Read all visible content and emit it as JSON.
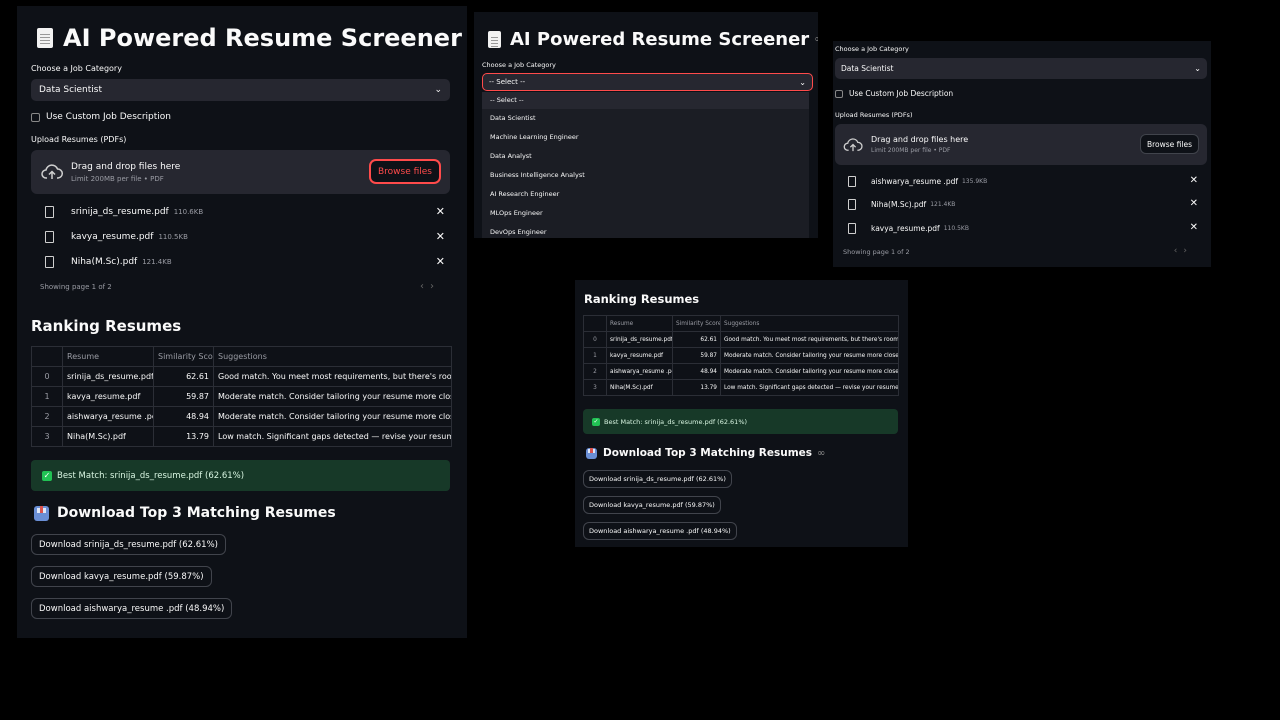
{
  "app": {
    "title": "AI Powered Resume Screener"
  },
  "form": {
    "category_label": "Choose a Job Category",
    "category_value": "Data Scientist",
    "category_placeholder": "-- Select --",
    "custom_jd_label": "Use Custom Job Description",
    "upload_label": "Upload Resumes (PDFs)",
    "drop_text": "Drag and drop files here",
    "limit_text": "Limit 200MB per file • PDF",
    "browse_label": "Browse files",
    "pager_text": "Showing page 1 of 2",
    "dropdown_options": [
      "-- Select --",
      "Data Scientist",
      "Machine Learning Engineer",
      "Data Analyst",
      "Business Intelligence Analyst",
      "AI Research Engineer",
      "MLOps Engineer",
      "DevOps Engineer"
    ]
  },
  "files_panel1": [
    {
      "name": "srinija_ds_resume.pdf",
      "size": "110.6KB"
    },
    {
      "name": "kavya_resume.pdf",
      "size": "110.5KB"
    },
    {
      "name": "Niha(M.Sc).pdf",
      "size": "121.4KB"
    }
  ],
  "files_panel3": [
    {
      "name": "aishwarya_resume .pdf",
      "size": "135.9KB"
    },
    {
      "name": "Niha(M.Sc).pdf",
      "size": "121.4KB"
    },
    {
      "name": "kavya_resume.pdf",
      "size": "110.5KB"
    }
  ],
  "ranking": {
    "heading": "Ranking Resumes",
    "columns": [
      "",
      "Resume",
      "Similarity Score",
      "Suggestions"
    ],
    "rows": [
      {
        "idx": "0",
        "resume": "srinija_ds_resume.pdf",
        "score": "62.61",
        "suggestion": "Good match. You meet most requirements, but there's room to improve."
      },
      {
        "idx": "1",
        "resume": "kavya_resume.pdf",
        "score": "59.87",
        "suggestion": "Moderate match. Consider tailoring your resume more closely to the job."
      },
      {
        "idx": "2",
        "resume": "aishwarya_resume .pdf",
        "score": "48.94",
        "suggestion": "Moderate match. Consider tailoring your resume more closely to the job."
      },
      {
        "idx": "3",
        "resume": "Niha(M.Sc).pdf",
        "score": "13.79",
        "suggestion": "Low match. Significant gaps detected — revise your resume to better match."
      }
    ],
    "best_match": "Best Match: srinija_ds_resume.pdf (62.61%)"
  },
  "download": {
    "heading": "Download Top 3 Matching Resumes",
    "buttons": [
      "Download srinija_ds_resume.pdf (62.61%)",
      "Download kavya_resume.pdf (59.87%)",
      "Download aishwarya_resume .pdf (48.94%)"
    ]
  },
  "colors": {
    "background": "#0e1117",
    "accent": "#ff4b4b",
    "success_bg": "#173928"
  }
}
